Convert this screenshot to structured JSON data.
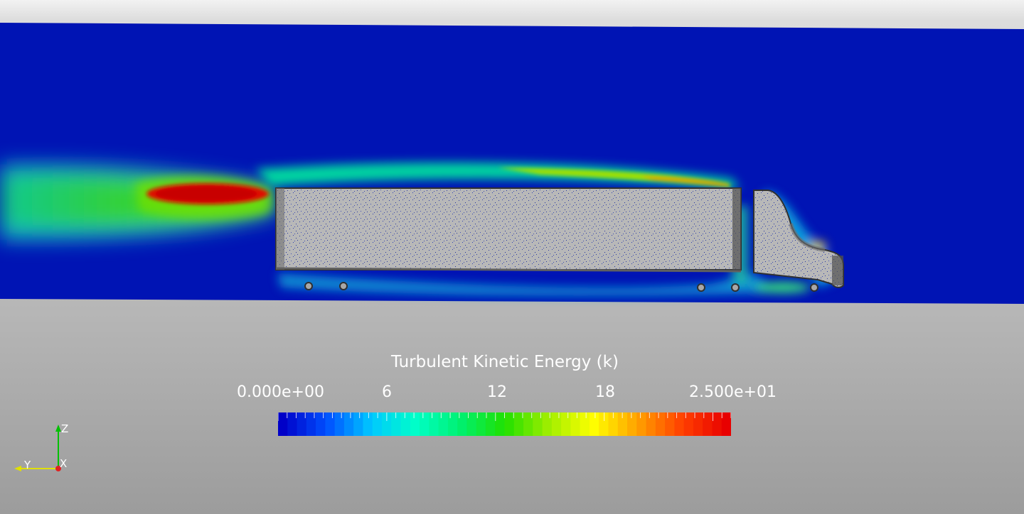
{
  "legend": {
    "title": "Turbulent Kinetic Energy (k)",
    "min_label": "0.000e+00",
    "ticks": [
      "6",
      "12",
      "18"
    ],
    "max_label": "2.500e+01",
    "range": [
      0,
      25
    ],
    "colormap": [
      "#0000c8",
      "#0050ff",
      "#00c8ff",
      "#00ffc8",
      "#00f070",
      "#20e000",
      "#a0ee00",
      "#ffff00",
      "#ffa000",
      "#ff4000",
      "#e80000"
    ]
  },
  "axes": {
    "z_label": "Z",
    "y_label": "Y",
    "x_label": "X",
    "z_color": "#00c000",
    "y_color": "#e0e000",
    "x_color": "#e02020"
  },
  "colors": {
    "field_background": "#0014b4",
    "truck_surface": "#b4b4b4",
    "high_turbulence": "#c80000"
  }
}
